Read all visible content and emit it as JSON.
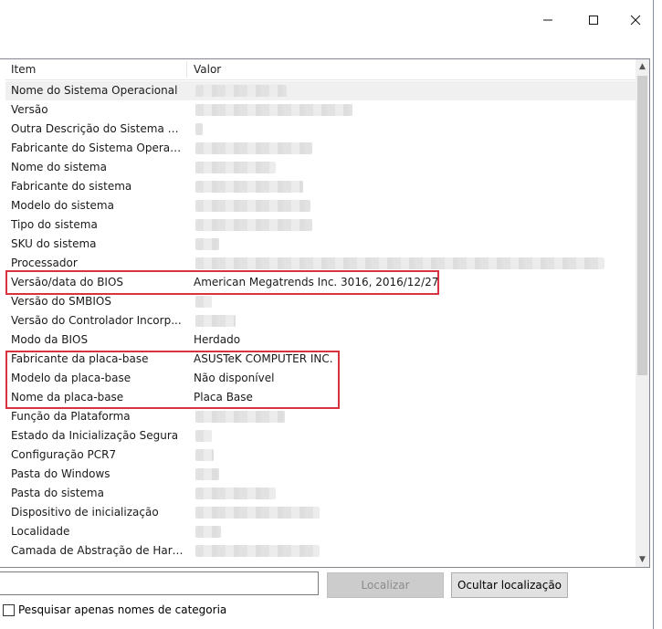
{
  "window": {
    "minimize_icon": "minimize-icon",
    "maximize_icon": "maximize-icon",
    "close_icon": "close-icon"
  },
  "table": {
    "columns": [
      "Item",
      "Valor"
    ],
    "rows": [
      {
        "item": "Nome do Sistema Operacional",
        "value": ""
      },
      {
        "item": "Versão",
        "value": ""
      },
      {
        "item": "Outra Descrição do Sistema O...",
        "value": ""
      },
      {
        "item": "Fabricante do Sistema Operaci...",
        "value": ""
      },
      {
        "item": "Nome do sistema",
        "value": ""
      },
      {
        "item": "Fabricante do sistema",
        "value": ""
      },
      {
        "item": "Modelo do sistema",
        "value": ""
      },
      {
        "item": "Tipo do sistema",
        "value": ""
      },
      {
        "item": "SKU do sistema",
        "value": ""
      },
      {
        "item": "Processador",
        "value": ""
      },
      {
        "item": "Versão/data do BIOS",
        "value": "American Megatrends Inc. 3016, 2016/12/27"
      },
      {
        "item": "Versão do SMBIOS",
        "value": ""
      },
      {
        "item": "Versão do Controlador Incorp...",
        "value": ""
      },
      {
        "item": "Modo da BIOS",
        "value": "Herdado"
      },
      {
        "item": "Fabricante da placa-base",
        "value": "ASUSTeK COMPUTER INC."
      },
      {
        "item": "Modelo da placa-base",
        "value": "Não disponível"
      },
      {
        "item": "Nome da placa-base",
        "value": "Placa Base"
      },
      {
        "item": "Função da Plataforma",
        "value": ""
      },
      {
        "item": "Estado da Inicialização Segura",
        "value": ""
      },
      {
        "item": "Configuração PCR7",
        "value": ""
      },
      {
        "item": "Pasta do Windows",
        "value": ""
      },
      {
        "item": "Pasta do sistema",
        "value": ""
      },
      {
        "item": "Dispositivo de inicialização",
        "value": ""
      },
      {
        "item": "Localidade",
        "value": ""
      },
      {
        "item": "Camada de Abstração de Hard...",
        "value": ""
      }
    ]
  },
  "search": {
    "value": "",
    "find_label": "Localizar",
    "hide_label": "Ocultar localização",
    "checkbox_label": "Pesquisar apenas nomes de categoria"
  },
  "colors": {
    "highlight": "#d9333f",
    "selection": "#f0f0f0"
  }
}
